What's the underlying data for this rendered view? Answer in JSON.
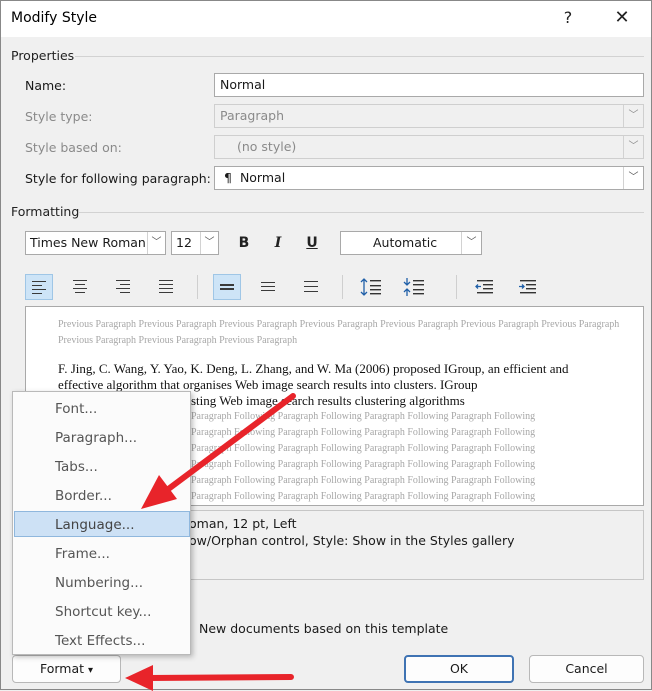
{
  "dialog": {
    "title": "Modify Style",
    "help": "?",
    "close": "✕"
  },
  "properties": {
    "section": "Properties",
    "name_label": "Name:",
    "name_value": "Normal",
    "style_type_label": "Style type:",
    "style_type_value": "Paragraph",
    "based_on_label": "Style based on:",
    "based_on_value": "(no style)",
    "following_label": "Style for following paragraph:",
    "following_value": "Normal",
    "following_mark": "¶"
  },
  "formatting": {
    "section": "Formatting",
    "font": "Times New Roman",
    "size": "12",
    "bold": "B",
    "italic": "I",
    "underline": "U",
    "color": "Automatic"
  },
  "preview": {
    "previous": "Previous Paragraph Previous Paragraph Previous Paragraph Previous Paragraph Previous Paragraph Previous Paragraph Previous Paragraph Previous Paragraph Previous Paragraph Previous Paragraph",
    "sample": "F. Jing, C. Wang, Y. Yao, K. Deng, L. Zhang, and W. Ma (2006) proposed IGroup, an efficient and effective algorithm that organises Web image search results into clusters. IGroup",
    "sample_tail": "sting Web image search results clustering algorithms",
    "following_lines": [
      "Paragraph Following Paragraph Following Paragraph Following Paragraph Following",
      "Paragraph Following Paragraph Following Paragraph Following Paragraph Following",
      "Paragraph Following Paragraph Following Paragraph Following Paragraph Following",
      "Paragraph Following Paragraph Following Paragraph Following Paragraph Following",
      "Paragraph Following Paragraph Following Paragraph Following Paragraph Following",
      "Paragraph Following Paragraph Following Paragraph Following Paragraph Following"
    ]
  },
  "description": {
    "line1": "oman, 12 pt, Left",
    "line2": "ow/Orphan control, Style: Show in the Styles gallery"
  },
  "template_option": "New documents based on this template",
  "menu": {
    "items": [
      "Font...",
      "Paragraph...",
      "Tabs...",
      "Border...",
      "Language...",
      "Frame...",
      "Numbering...",
      "Shortcut key...",
      "Text Effects..."
    ]
  },
  "buttons": {
    "format": "Format",
    "format_caret": "▾",
    "ok": "OK",
    "cancel": "Cancel"
  },
  "colors": {
    "arrow": "#e8242a",
    "highlight": "#cde1f5",
    "active_tool": "#cde4f7"
  }
}
